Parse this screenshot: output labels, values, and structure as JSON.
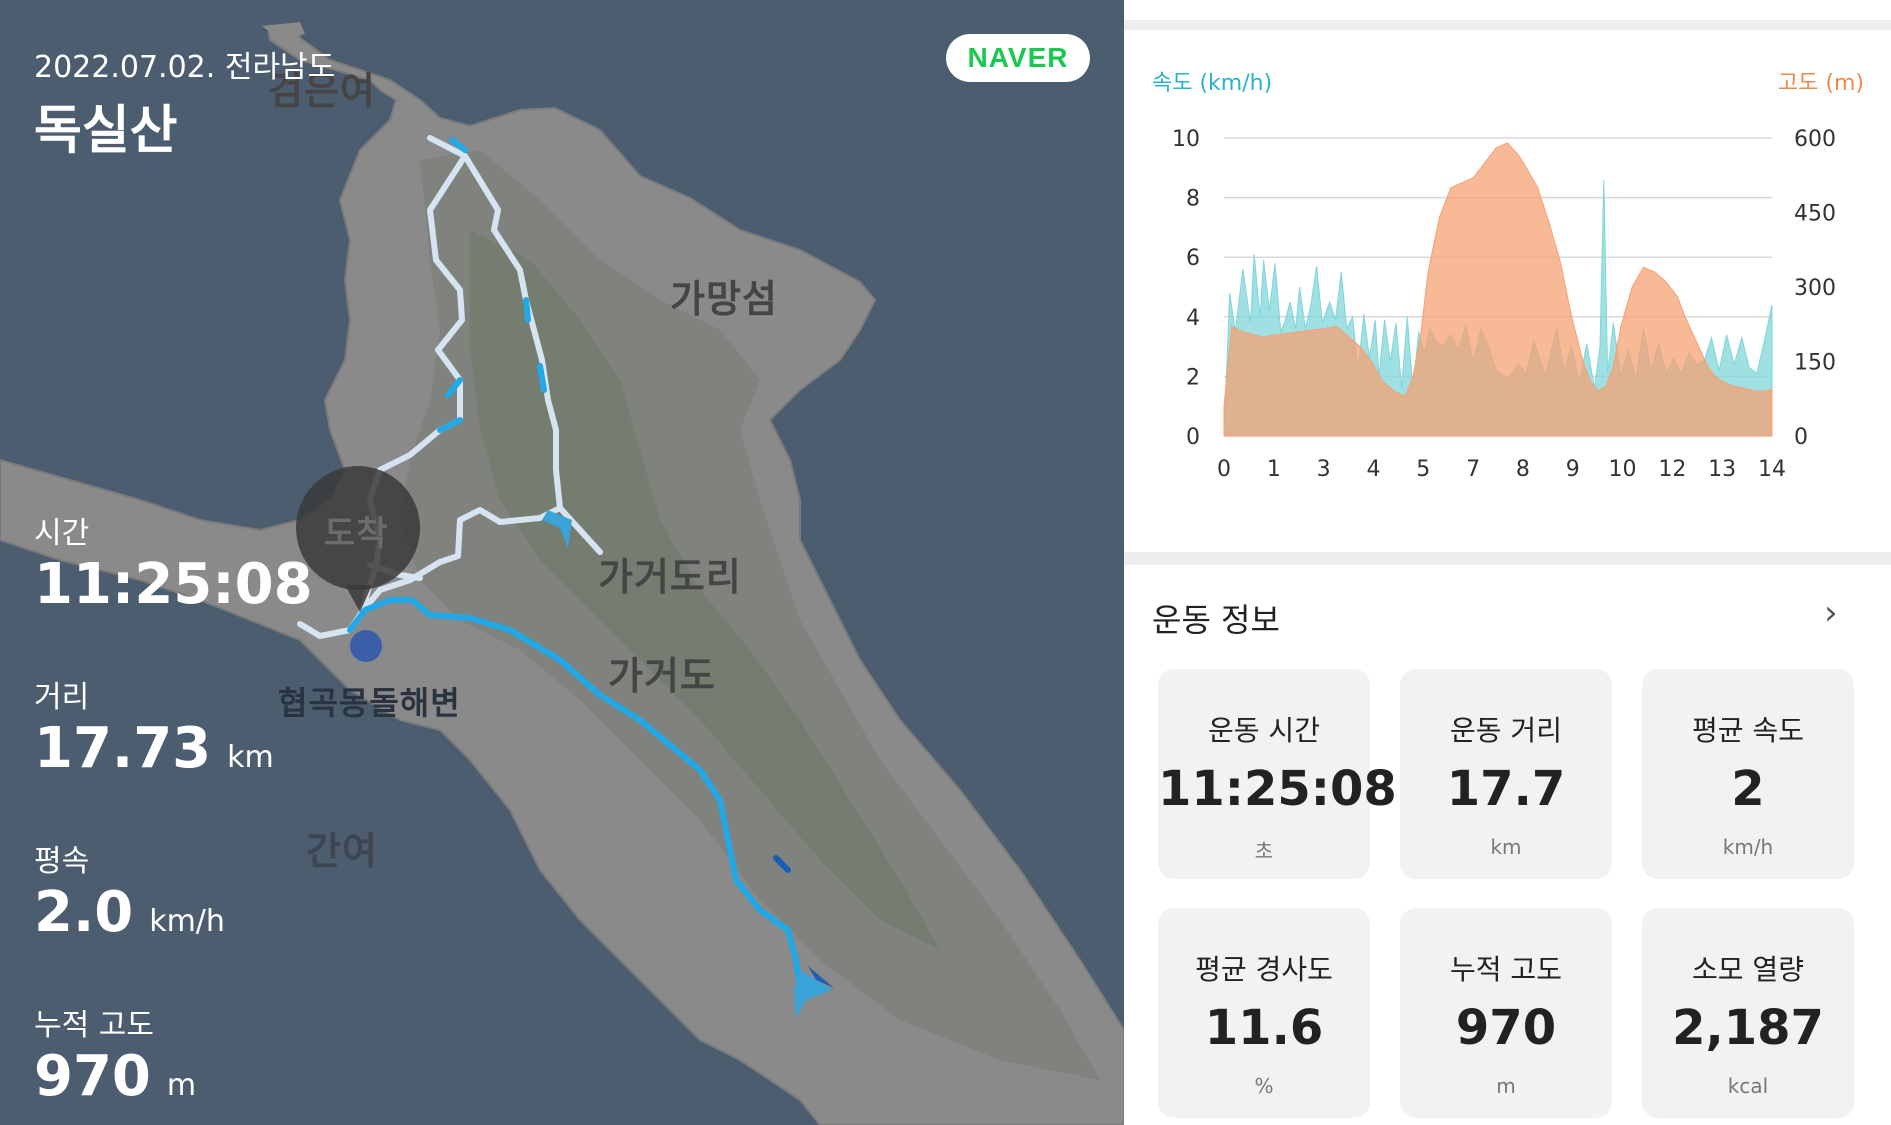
{
  "map": {
    "date_region": "2022.07.02. 전라남도",
    "title": "독실산",
    "brand": "NAVER",
    "places": [
      "검은여",
      "가망섬",
      "가거도리",
      "가거도",
      "간여",
      "협곡몽돌해변"
    ],
    "marker_text": "도착",
    "stats": [
      {
        "label": "시간",
        "value": "11:25:08",
        "unit": ""
      },
      {
        "label": "거리",
        "value": "17.73",
        "unit": "km"
      },
      {
        "label": "평속",
        "value": "2.0",
        "unit": "km/h"
      },
      {
        "label": "누적 고도",
        "value": "970",
        "unit": "m"
      }
    ]
  },
  "chart_data": {
    "type": "area",
    "title": "",
    "ylabel": "속도 (km/h)",
    "y2label": "고도 (m)",
    "xlabel": "",
    "x_ticks": [
      "0",
      "1",
      "3",
      "4",
      "5",
      "7",
      "8",
      "9",
      "10",
      "12",
      "13",
      "14"
    ],
    "y_ticks": [
      "0",
      "2",
      "4",
      "6",
      "8",
      "10"
    ],
    "y2_ticks": [
      "0",
      "150",
      "300",
      "450",
      "600"
    ],
    "ylim": [
      0,
      10
    ],
    "y2lim": [
      0,
      600
    ],
    "grid": true,
    "series": [
      {
        "name": "속도 (km/h)",
        "axis": "left",
        "color": "#7fd6d9",
        "x": [
          0,
          0.15,
          0.3,
          0.5,
          0.7,
          0.8,
          0.95,
          1.05,
          1.2,
          1.35,
          1.5,
          1.6,
          1.75,
          1.9,
          2.0,
          2.15,
          2.3,
          2.45,
          2.6,
          2.8,
          2.95,
          3.1,
          3.25,
          3.4,
          3.55,
          3.7,
          3.85,
          4.0,
          4.1,
          4.25,
          4.4,
          4.55,
          4.7,
          4.85,
          5.0,
          5.15,
          5.3,
          5.45,
          5.6,
          5.8,
          6.0,
          6.2,
          6.4,
          6.6,
          6.8,
          7.0,
          7.2,
          7.5,
          7.8,
          8.0,
          8.2,
          8.5,
          8.8,
          9.0,
          9.2,
          9.4,
          9.6,
          9.8,
          9.95,
          10.05,
          10.15,
          10.3,
          10.5,
          10.7,
          10.9,
          11.1,
          11.3,
          11.5,
          11.7,
          11.9,
          12.1,
          12.3,
          12.5,
          12.7,
          12.9,
          13.1,
          13.3,
          13.5,
          13.7,
          13.9,
          14.1,
          14.3,
          14.5
        ],
        "values": [
          0,
          4.8,
          3.5,
          5.6,
          3.8,
          6.1,
          4.0,
          5.9,
          4.2,
          5.8,
          3.5,
          3.8,
          4.5,
          3.6,
          5.0,
          3.6,
          4.4,
          5.7,
          3.8,
          4.5,
          3.9,
          5.5,
          3.6,
          4.0,
          2.2,
          4.1,
          2.6,
          3.9,
          2.0,
          3.9,
          2.5,
          3.8,
          1.6,
          4.0,
          1.5,
          3.5,
          2.8,
          3.6,
          3.2,
          3.0,
          3.4,
          2.9,
          3.7,
          2.5,
          3.6,
          3.0,
          2.2,
          1.9,
          2.4,
          2.1,
          3.2,
          2.0,
          3.6,
          2.2,
          3.0,
          1.8,
          3.1,
          1.6,
          3.0,
          8.6,
          2.1,
          3.8,
          2.0,
          2.9,
          1.9,
          3.6,
          2.2,
          3.1,
          2.1,
          2.6,
          2.1,
          2.8,
          2.4,
          2.5,
          3.3,
          2.2,
          3.4,
          2.4,
          3.3,
          2.3,
          2.1,
          3.2,
          4.4
        ]
      },
      {
        "name": "고도 (m)",
        "axis": "right",
        "color": "#f5a173",
        "x": [
          0,
          0.2,
          0.5,
          1.0,
          1.5,
          2.0,
          2.5,
          3.0,
          3.3,
          3.6,
          3.9,
          4.2,
          4.5,
          4.8,
          5.0,
          5.2,
          5.4,
          5.7,
          6.0,
          6.3,
          6.6,
          6.9,
          7.2,
          7.5,
          7.8,
          8.0,
          8.3,
          8.6,
          8.9,
          9.2,
          9.5,
          9.7,
          9.9,
          10.1,
          10.3,
          10.5,
          10.8,
          11.1,
          11.4,
          11.7,
          12.0,
          12.2,
          12.5,
          12.8,
          13.0,
          13.2,
          13.5,
          13.8,
          14.1,
          14.3,
          14.5
        ],
        "values": [
          60,
          220,
          210,
          200,
          205,
          210,
          215,
          220,
          200,
          180,
          150,
          110,
          90,
          80,
          120,
          200,
          330,
          440,
          500,
          510,
          520,
          550,
          580,
          590,
          565,
          540,
          500,
          430,
          350,
          240,
          150,
          110,
          90,
          100,
          140,
          220,
          300,
          340,
          330,
          310,
          280,
          240,
          190,
          140,
          120,
          110,
          100,
          95,
          90,
          90,
          95
        ]
      }
    ]
  },
  "info": {
    "title": "운동 정보",
    "tiles": [
      {
        "label": "운동 시간",
        "value": "11:25:08",
        "unit": "초"
      },
      {
        "label": "운동 거리",
        "value": "17.7",
        "unit": "km"
      },
      {
        "label": "평균 속도",
        "value": "2",
        "unit": "km/h"
      },
      {
        "label": "평균 경사도",
        "value": "11.6",
        "unit": "%"
      },
      {
        "label": "누적 고도",
        "value": "970",
        "unit": "m"
      },
      {
        "label": "소모 열량",
        "value": "2,187",
        "unit": "kcal"
      }
    ]
  }
}
